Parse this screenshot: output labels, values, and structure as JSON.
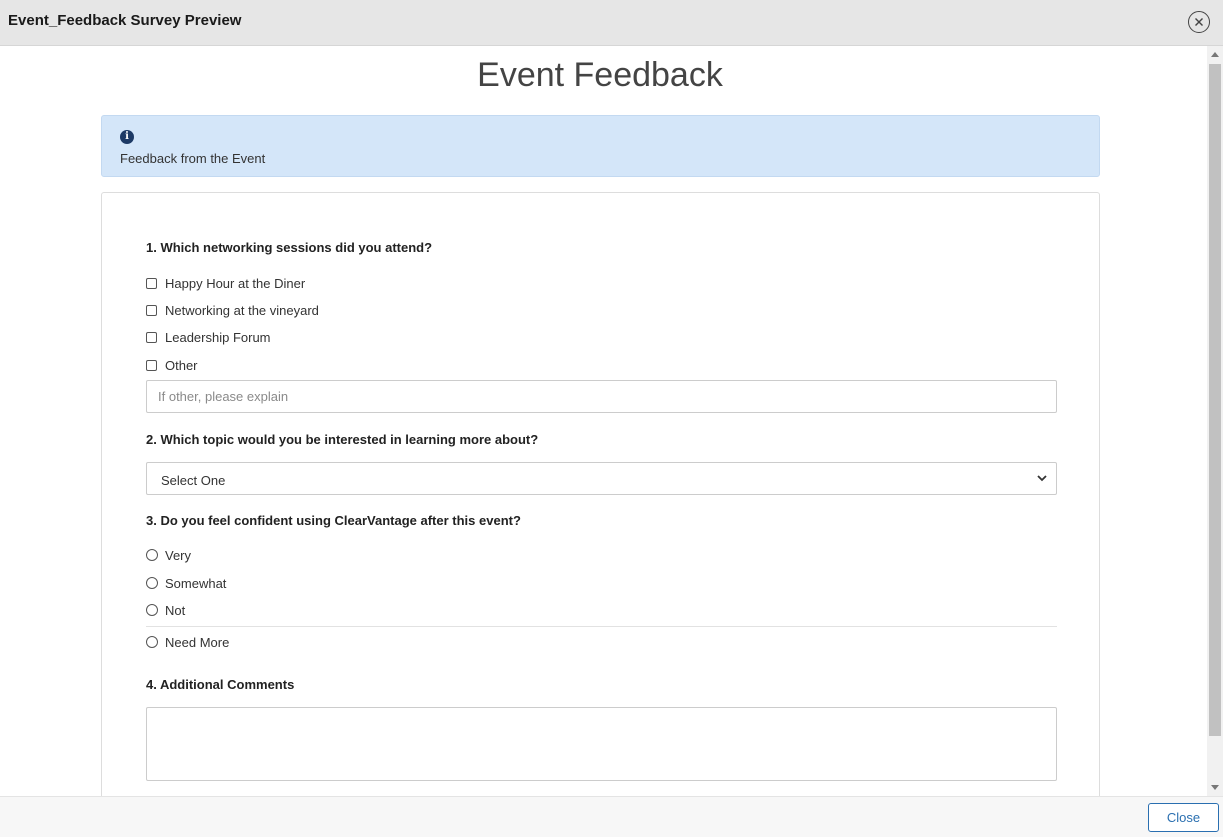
{
  "modal": {
    "title": "Event_Feedback Survey Preview",
    "close_icon": "close-circle-icon"
  },
  "survey": {
    "title": "Event Feedback",
    "info": {
      "icon": "info-icon",
      "glyph": "i",
      "text": "Feedback from the Event"
    },
    "q1": {
      "label": "1. Which networking sessions did you attend?",
      "options": [
        "Happy Hour at the Diner",
        "Networking at the vineyard",
        "Leadership Forum",
        "Other"
      ],
      "other_placeholder": "If other, please explain"
    },
    "q2": {
      "label": "2. Which topic would you be interested in learning more about?",
      "selected": "Select One"
    },
    "q3": {
      "label": "3. Do you feel confident using ClearVantage after this event?",
      "options": [
        "Very",
        "Somewhat",
        "Not",
        "Need More"
      ]
    },
    "q4": {
      "label": "4. Additional Comments",
      "value": ""
    }
  },
  "footer": {
    "close_label": "Close"
  }
}
